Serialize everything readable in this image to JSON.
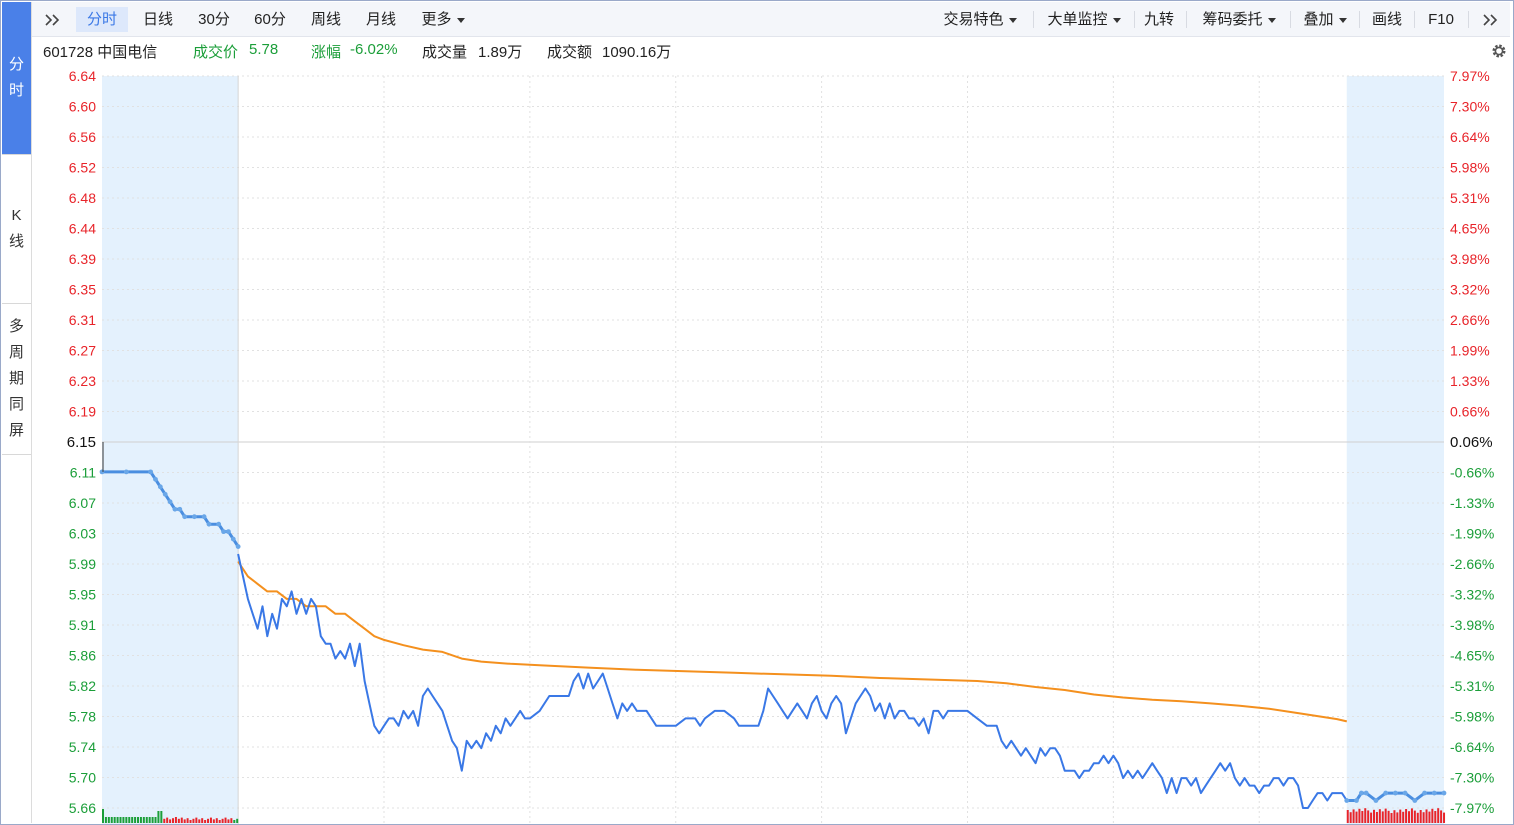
{
  "side_tabs": {
    "fenshi": "分时",
    "kline": "K线",
    "multi": "多周期同屏"
  },
  "toolbar": {
    "collapse_icon": "double-chevron-right-icon",
    "tabs": [
      "分时",
      "日线",
      "30分",
      "60分",
      "周线",
      "月线"
    ],
    "more": "更多",
    "right_items": [
      "交易特色",
      "大单监控",
      "九转",
      "筹码委托",
      "叠加",
      "画线",
      "F10"
    ],
    "expand_icon": "double-chevron-right-icon"
  },
  "info": {
    "code_name": "601728 中国电信",
    "price_label": "成交价",
    "price_value": "5.78",
    "change_label": "涨幅",
    "change_value": "-6.02%",
    "volume_label": "成交量",
    "volume_value": "1.89万",
    "amount_label": "成交额",
    "amount_value": "1090.16万",
    "settings_icon": "gear-icon"
  },
  "colors": {
    "up": "#e8242a",
    "down": "#1b9e39",
    "price_line": "#3a78e6",
    "avg_line": "#f4901e",
    "preopen_bg": "#e4f1fd",
    "grid": "#e1e1e1",
    "base_text": "#111111"
  },
  "chart_data": {
    "type": "line",
    "title": "",
    "y_left_ticks": [
      "6.64",
      "6.60",
      "6.56",
      "6.52",
      "6.48",
      "6.44",
      "6.39",
      "6.35",
      "6.31",
      "6.27",
      "6.23",
      "6.19",
      "6.15",
      "6.11",
      "6.07",
      "6.03",
      "5.99",
      "5.95",
      "5.91",
      "5.86",
      "5.82",
      "5.78",
      "5.74",
      "5.70",
      "5.66"
    ],
    "y_right_ticks": [
      "7.97%",
      "7.30%",
      "6.64%",
      "5.98%",
      "5.31%",
      "4.65%",
      "3.98%",
      "3.32%",
      "2.66%",
      "1.99%",
      "1.33%",
      "0.66%",
      "0.06%",
      "-0.66%",
      "-1.33%",
      "-1.99%",
      "-2.66%",
      "-3.32%",
      "-3.98%",
      "-4.65%",
      "-5.31%",
      "-5.98%",
      "-6.64%",
      "-7.30%",
      "-7.97%"
    ],
    "base_price": 6.15,
    "ylim": [
      5.66,
      6.64
    ],
    "x_range": [
      0,
      276
    ],
    "session_split": [
      28,
      256
    ],
    "vertical_grid_x": [
      58,
      88,
      118,
      148,
      178,
      208,
      238
    ],
    "preopen_price": [
      [
        0,
        6.11
      ],
      [
        5,
        6.11
      ],
      [
        10,
        6.11
      ],
      [
        11,
        6.1
      ],
      [
        12,
        6.09
      ],
      [
        13,
        6.08
      ],
      [
        14,
        6.07
      ],
      [
        15,
        6.06
      ],
      [
        16,
        6.06
      ],
      [
        17,
        6.05
      ],
      [
        19,
        6.05
      ],
      [
        21,
        6.05
      ],
      [
        22,
        6.04
      ],
      [
        24,
        6.04
      ],
      [
        25,
        6.03
      ],
      [
        26,
        6.03
      ],
      [
        27,
        6.02
      ],
      [
        28,
        6.01
      ]
    ],
    "series": [
      {
        "name": "",
        "values": [
          [
            28,
            6.0
          ],
          [
            29,
            5.97
          ],
          [
            30,
            5.94
          ],
          [
            31,
            5.92
          ],
          [
            32,
            5.9
          ],
          [
            33,
            5.93
          ],
          [
            34,
            5.89
          ],
          [
            35,
            5.92
          ],
          [
            36,
            5.9
          ],
          [
            37,
            5.94
          ],
          [
            38,
            5.93
          ],
          [
            39,
            5.95
          ],
          [
            40,
            5.92
          ],
          [
            41,
            5.94
          ],
          [
            42,
            5.92
          ],
          [
            43,
            5.94
          ],
          [
            44,
            5.93
          ],
          [
            45,
            5.89
          ],
          [
            46,
            5.88
          ],
          [
            47,
            5.88
          ],
          [
            48,
            5.86
          ],
          [
            49,
            5.87
          ],
          [
            50,
            5.86
          ],
          [
            51,
            5.88
          ],
          [
            52,
            5.85
          ],
          [
            53,
            5.88
          ],
          [
            54,
            5.83
          ],
          [
            55,
            5.8
          ],
          [
            56,
            5.77
          ],
          [
            57,
            5.76
          ],
          [
            58,
            5.77
          ],
          [
            59,
            5.78
          ],
          [
            60,
            5.78
          ],
          [
            61,
            5.77
          ],
          [
            62,
            5.79
          ],
          [
            63,
            5.78
          ],
          [
            64,
            5.79
          ],
          [
            65,
            5.77
          ],
          [
            66,
            5.81
          ],
          [
            67,
            5.82
          ],
          [
            68,
            5.81
          ],
          [
            69,
            5.8
          ],
          [
            70,
            5.79
          ],
          [
            71,
            5.77
          ],
          [
            72,
            5.75
          ],
          [
            73,
            5.74
          ],
          [
            74,
            5.71
          ],
          [
            75,
            5.75
          ],
          [
            76,
            5.74
          ],
          [
            77,
            5.75
          ],
          [
            78,
            5.74
          ],
          [
            79,
            5.76
          ],
          [
            80,
            5.75
          ],
          [
            81,
            5.77
          ],
          [
            82,
            5.76
          ],
          [
            83,
            5.78
          ],
          [
            84,
            5.77
          ],
          [
            85,
            5.78
          ],
          [
            86,
            5.79
          ],
          [
            87,
            5.78
          ],
          [
            88,
            5.78
          ],
          [
            90,
            5.79
          ],
          [
            92,
            5.81
          ],
          [
            94,
            5.81
          ],
          [
            96,
            5.81
          ],
          [
            97,
            5.83
          ],
          [
            98,
            5.84
          ],
          [
            99,
            5.82
          ],
          [
            100,
            5.84
          ],
          [
            101,
            5.82
          ],
          [
            102,
            5.83
          ],
          [
            103,
            5.84
          ],
          [
            104,
            5.82
          ],
          [
            105,
            5.8
          ],
          [
            106,
            5.78
          ],
          [
            107,
            5.8
          ],
          [
            108,
            5.79
          ],
          [
            109,
            5.8
          ],
          [
            110,
            5.79
          ],
          [
            112,
            5.79
          ],
          [
            114,
            5.77
          ],
          [
            116,
            5.77
          ],
          [
            118,
            5.77
          ],
          [
            120,
            5.78
          ],
          [
            122,
            5.78
          ],
          [
            123,
            5.77
          ],
          [
            124,
            5.78
          ],
          [
            126,
            5.79
          ],
          [
            128,
            5.79
          ],
          [
            130,
            5.78
          ],
          [
            131,
            5.77
          ],
          [
            133,
            5.77
          ],
          [
            135,
            5.77
          ],
          [
            136,
            5.79
          ],
          [
            137,
            5.82
          ],
          [
            138,
            5.81
          ],
          [
            139,
            5.8
          ],
          [
            140,
            5.79
          ],
          [
            141,
            5.78
          ],
          [
            142,
            5.79
          ],
          [
            143,
            5.8
          ],
          [
            144,
            5.79
          ],
          [
            145,
            5.78
          ],
          [
            146,
            5.8
          ],
          [
            147,
            5.81
          ],
          [
            148,
            5.79
          ],
          [
            149,
            5.78
          ],
          [
            150,
            5.8
          ],
          [
            151,
            5.81
          ],
          [
            152,
            5.8
          ],
          [
            153,
            5.76
          ],
          [
            154,
            5.78
          ],
          [
            155,
            5.8
          ],
          [
            156,
            5.81
          ],
          [
            157,
            5.82
          ],
          [
            158,
            5.81
          ],
          [
            159,
            5.79
          ],
          [
            160,
            5.8
          ],
          [
            161,
            5.78
          ],
          [
            162,
            5.8
          ],
          [
            163,
            5.78
          ],
          [
            164,
            5.79
          ],
          [
            165,
            5.79
          ],
          [
            166,
            5.78
          ],
          [
            167,
            5.78
          ],
          [
            168,
            5.77
          ],
          [
            169,
            5.78
          ],
          [
            170,
            5.76
          ],
          [
            171,
            5.79
          ],
          [
            172,
            5.79
          ],
          [
            173,
            5.78
          ],
          [
            174,
            5.79
          ],
          [
            176,
            5.79
          ],
          [
            178,
            5.79
          ],
          [
            180,
            5.78
          ],
          [
            182,
            5.77
          ],
          [
            184,
            5.77
          ],
          [
            185,
            5.75
          ],
          [
            186,
            5.74
          ],
          [
            187,
            5.75
          ],
          [
            188,
            5.74
          ],
          [
            189,
            5.73
          ],
          [
            190,
            5.74
          ],
          [
            191,
            5.73
          ],
          [
            192,
            5.72
          ],
          [
            193,
            5.74
          ],
          [
            194,
            5.73
          ],
          [
            195,
            5.74
          ],
          [
            196,
            5.74
          ],
          [
            197,
            5.73
          ],
          [
            198,
            5.71
          ],
          [
            199,
            5.71
          ],
          [
            200,
            5.71
          ],
          [
            201,
            5.7
          ],
          [
            202,
            5.71
          ],
          [
            203,
            5.71
          ],
          [
            204,
            5.72
          ],
          [
            205,
            5.72
          ],
          [
            206,
            5.73
          ],
          [
            207,
            5.72
          ],
          [
            208,
            5.73
          ],
          [
            209,
            5.72
          ],
          [
            210,
            5.7
          ],
          [
            211,
            5.71
          ],
          [
            212,
            5.7
          ],
          [
            213,
            5.71
          ],
          [
            214,
            5.7
          ],
          [
            215,
            5.71
          ],
          [
            216,
            5.72
          ],
          [
            217,
            5.71
          ],
          [
            218,
            5.7
          ],
          [
            219,
            5.68
          ],
          [
            220,
            5.7
          ],
          [
            221,
            5.68
          ],
          [
            222,
            5.7
          ],
          [
            223,
            5.7
          ],
          [
            224,
            5.69
          ],
          [
            225,
            5.7
          ],
          [
            226,
            5.68
          ],
          [
            227,
            5.69
          ],
          [
            228,
            5.7
          ],
          [
            229,
            5.71
          ],
          [
            230,
            5.72
          ],
          [
            231,
            5.71
          ],
          [
            232,
            5.72
          ],
          [
            233,
            5.7
          ],
          [
            234,
            5.69
          ],
          [
            235,
            5.7
          ],
          [
            236,
            5.69
          ],
          [
            237,
            5.69
          ],
          [
            238,
            5.68
          ],
          [
            239,
            5.69
          ],
          [
            240,
            5.69
          ],
          [
            241,
            5.7
          ],
          [
            242,
            5.7
          ],
          [
            243,
            5.69
          ],
          [
            244,
            5.7
          ],
          [
            245,
            5.7
          ],
          [
            246,
            5.69
          ],
          [
            247,
            5.66
          ],
          [
            248,
            5.66
          ],
          [
            249,
            5.67
          ],
          [
            250,
            5.68
          ],
          [
            251,
            5.68
          ],
          [
            252,
            5.67
          ],
          [
            253,
            5.68
          ],
          [
            254,
            5.68
          ],
          [
            255,
            5.68
          ],
          [
            256,
            5.67
          ]
        ]
      },
      {
        "name": "",
        "values": [
          [
            28,
            5.99
          ],
          [
            30,
            5.97
          ],
          [
            32,
            5.96
          ],
          [
            34,
            5.95
          ],
          [
            36,
            5.95
          ],
          [
            38,
            5.94
          ],
          [
            40,
            5.94
          ],
          [
            42,
            5.93
          ],
          [
            44,
            5.93
          ],
          [
            46,
            5.93
          ],
          [
            48,
            5.92
          ],
          [
            50,
            5.92
          ],
          [
            52,
            5.91
          ],
          [
            54,
            5.9
          ],
          [
            56,
            5.89
          ],
          [
            58,
            5.885
          ],
          [
            62,
            5.878
          ],
          [
            66,
            5.872
          ],
          [
            70,
            5.869
          ],
          [
            74,
            5.86
          ],
          [
            78,
            5.856
          ],
          [
            84,
            5.853
          ],
          [
            90,
            5.851
          ],
          [
            100,
            5.848
          ],
          [
            110,
            5.845
          ],
          [
            120,
            5.843
          ],
          [
            130,
            5.841
          ],
          [
            140,
            5.839
          ],
          [
            150,
            5.837
          ],
          [
            160,
            5.834
          ],
          [
            170,
            5.832
          ],
          [
            180,
            5.83
          ],
          [
            186,
            5.827
          ],
          [
            192,
            5.822
          ],
          [
            198,
            5.818
          ],
          [
            204,
            5.812
          ],
          [
            210,
            5.808
          ],
          [
            216,
            5.805
          ],
          [
            222,
            5.803
          ],
          [
            228,
            5.8
          ],
          [
            234,
            5.797
          ],
          [
            240,
            5.793
          ],
          [
            246,
            5.787
          ],
          [
            250,
            5.783
          ],
          [
            254,
            5.779
          ],
          [
            256,
            5.776
          ]
        ]
      }
    ],
    "postclose_price": [
      [
        256,
        5.67
      ],
      [
        258,
        5.67
      ],
      [
        259,
        5.68
      ],
      [
        260,
        5.68
      ],
      [
        262,
        5.67
      ],
      [
        264,
        5.68
      ],
      [
        266,
        5.68
      ],
      [
        268,
        5.68
      ],
      [
        270,
        5.67
      ],
      [
        272,
        5.68
      ],
      [
        274,
        5.68
      ],
      [
        276,
        5.68
      ]
    ],
    "grid": true
  }
}
